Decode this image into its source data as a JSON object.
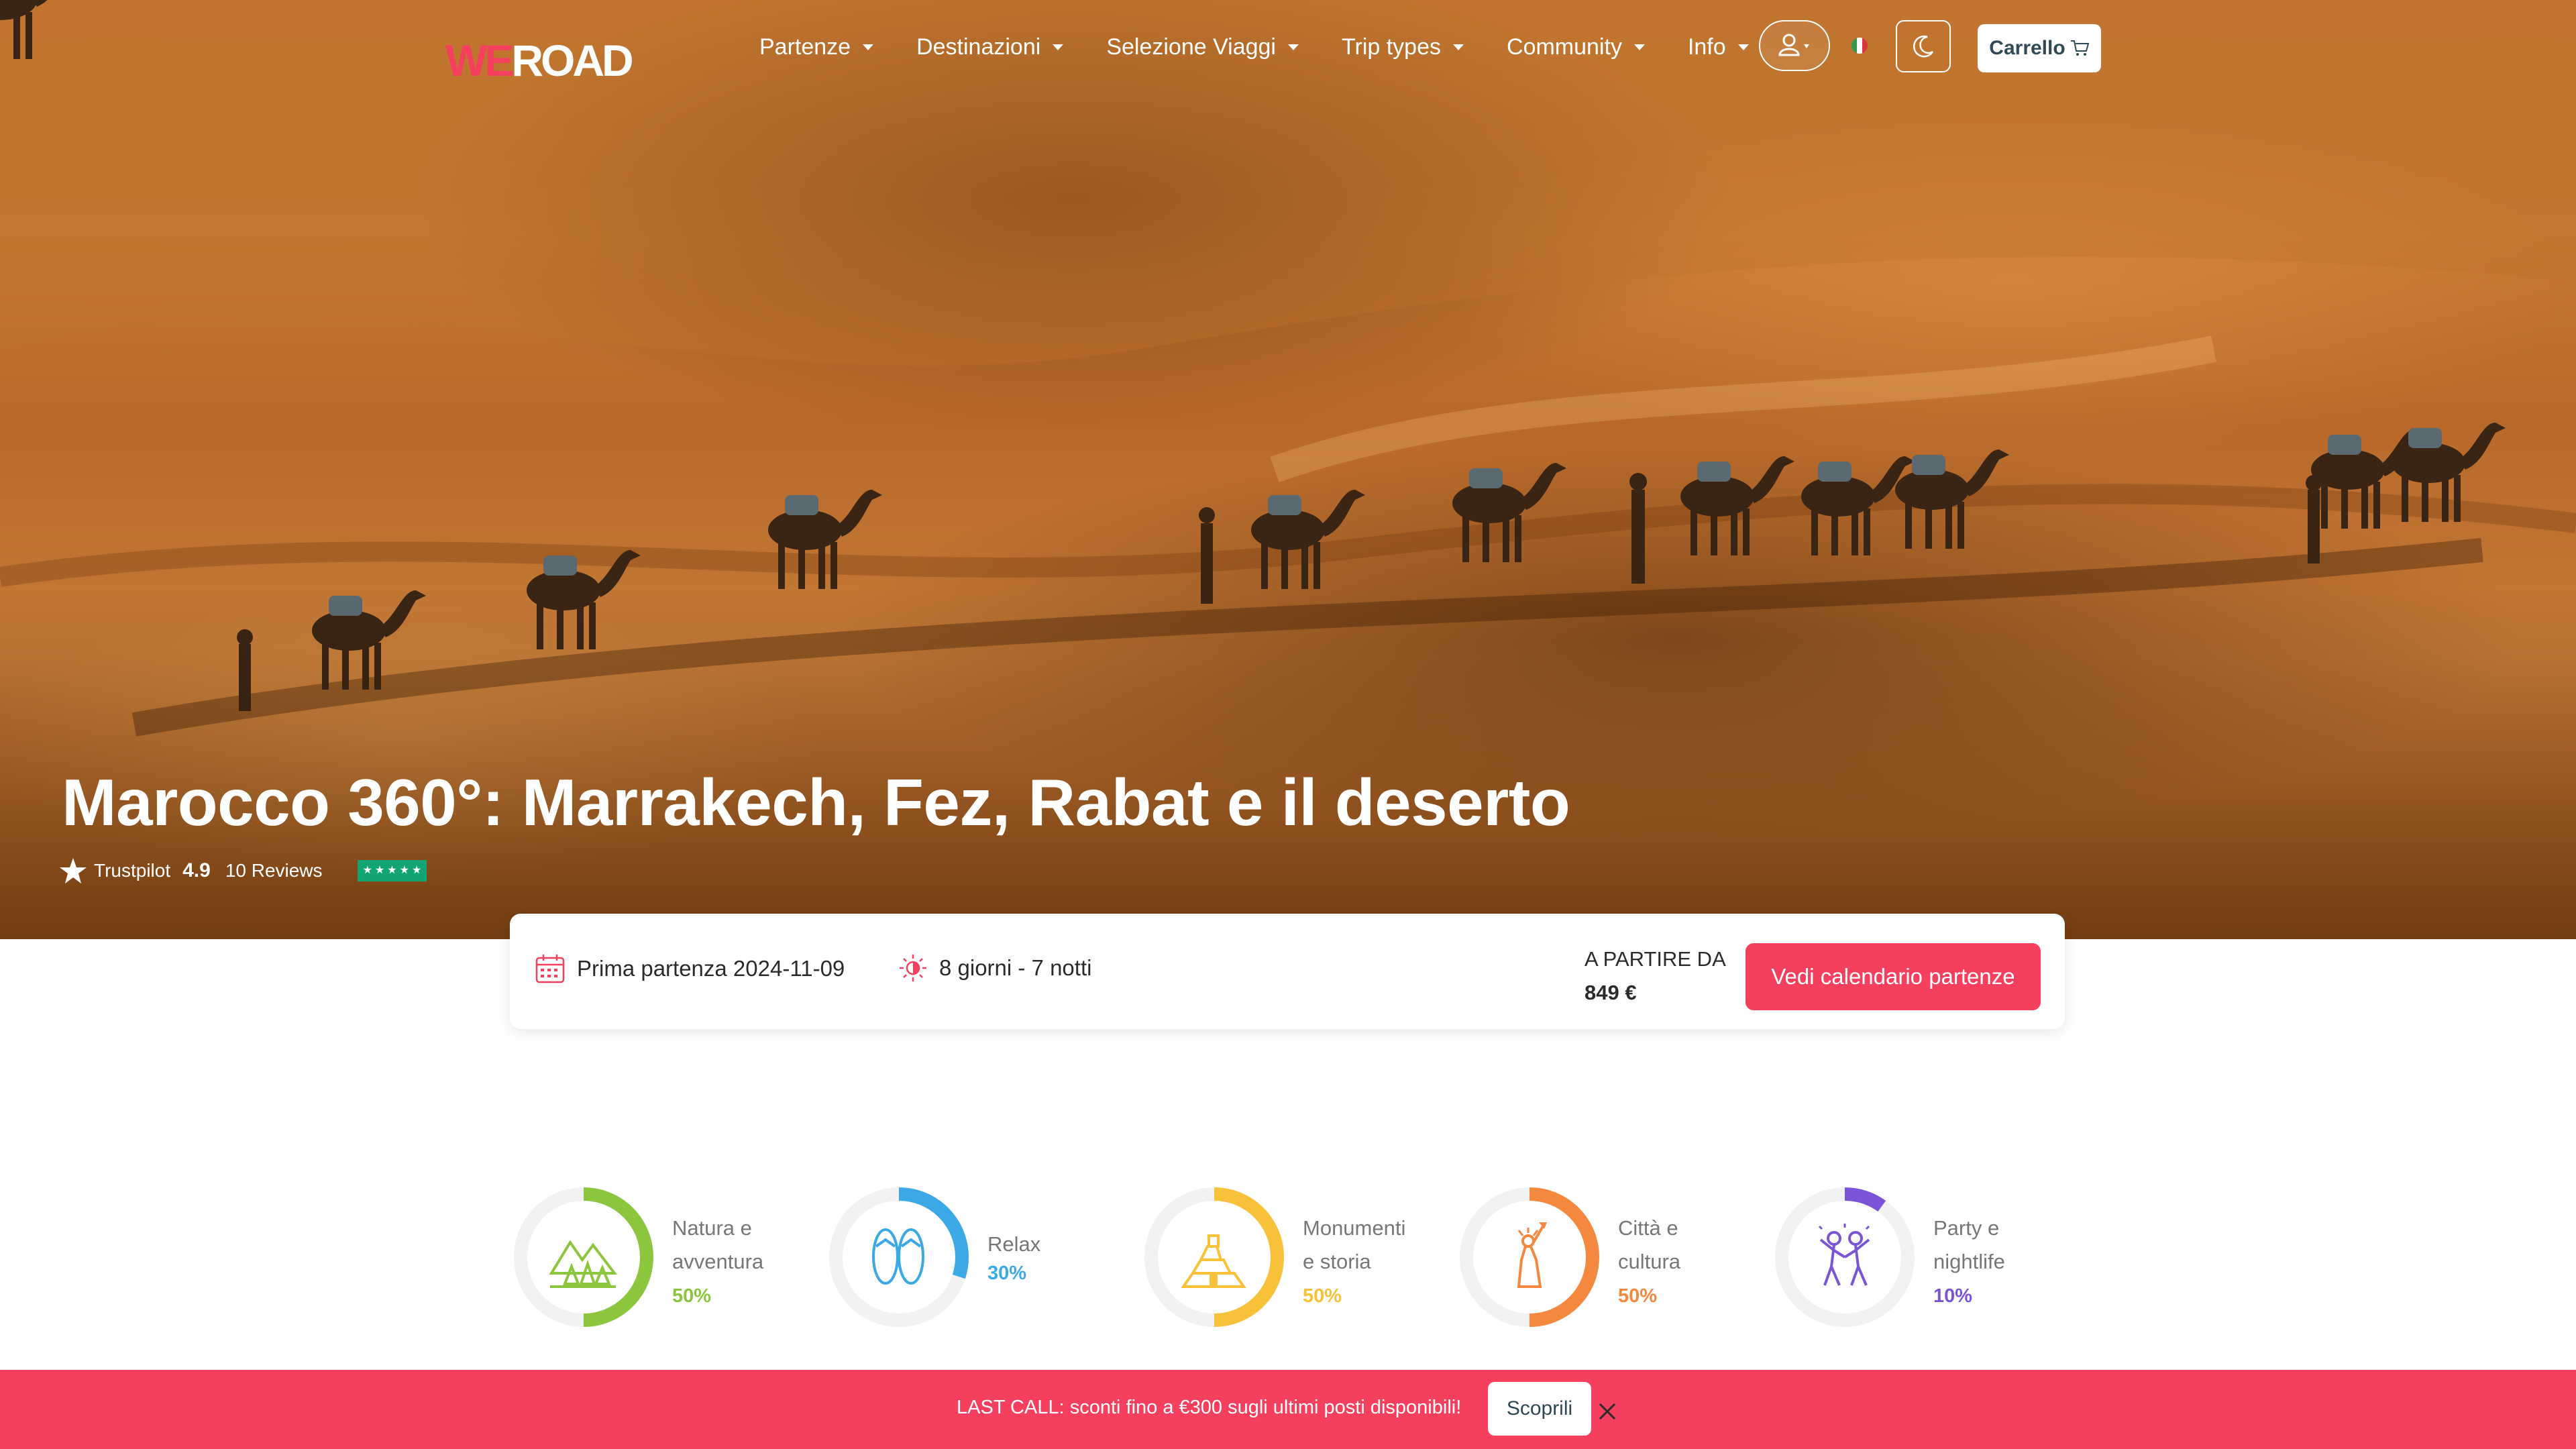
{
  "nav": {
    "logo_we": "WE",
    "logo_road": "ROAD",
    "menu": [
      "Partenze",
      "Destinazioni",
      "Selezione Viaggi",
      "Trip types",
      "Community",
      "Info"
    ],
    "cart_label": "Carrello"
  },
  "hero": {
    "title": "Marocco 360°: Marrakech, Fez, Rabat e il deserto",
    "trustpilot_label": "Trustpilot",
    "rating": "4.9",
    "reviews": "10 Reviews"
  },
  "trip": {
    "first_departure": "Prima partenza 2024-11-09",
    "duration": "8 giorni - 7 notti",
    "price_label": "A PARTIRE DA",
    "price": "849 €",
    "calendar_button": "Vedi calendario partenze"
  },
  "categories": [
    {
      "line1": "Natura e",
      "line2": "avventura",
      "percent_text": "50%",
      "percent": 50,
      "color": "#8cc63f",
      "icon": "mountains-trees-icon"
    },
    {
      "line1": "Relax",
      "line2": "",
      "percent_text": "30%",
      "percent": 30,
      "color": "#3ba9e6",
      "icon": "flip-flops-icon"
    },
    {
      "line1": "Monumenti",
      "line2": "e storia",
      "percent_text": "50%",
      "percent": 50,
      "color": "#f8c13a",
      "icon": "pyramid-icon"
    },
    {
      "line1": "Città e",
      "line2": "cultura",
      "percent_text": "50%",
      "percent": 50,
      "color": "#f4883f",
      "icon": "statue-of-liberty-icon"
    },
    {
      "line1": "Party e",
      "line2": "nightlife",
      "percent_text": "10%",
      "percent": 10,
      "color": "#7b55d8",
      "icon": "dancers-icon"
    }
  ],
  "banner": {
    "text": "LAST CALL: sconti fino a €300 sugli ultimi posti disponibili!",
    "button": "Scoprili"
  },
  "colors": {
    "accent": "#f43f5e",
    "trustpilot": "#12a572"
  }
}
